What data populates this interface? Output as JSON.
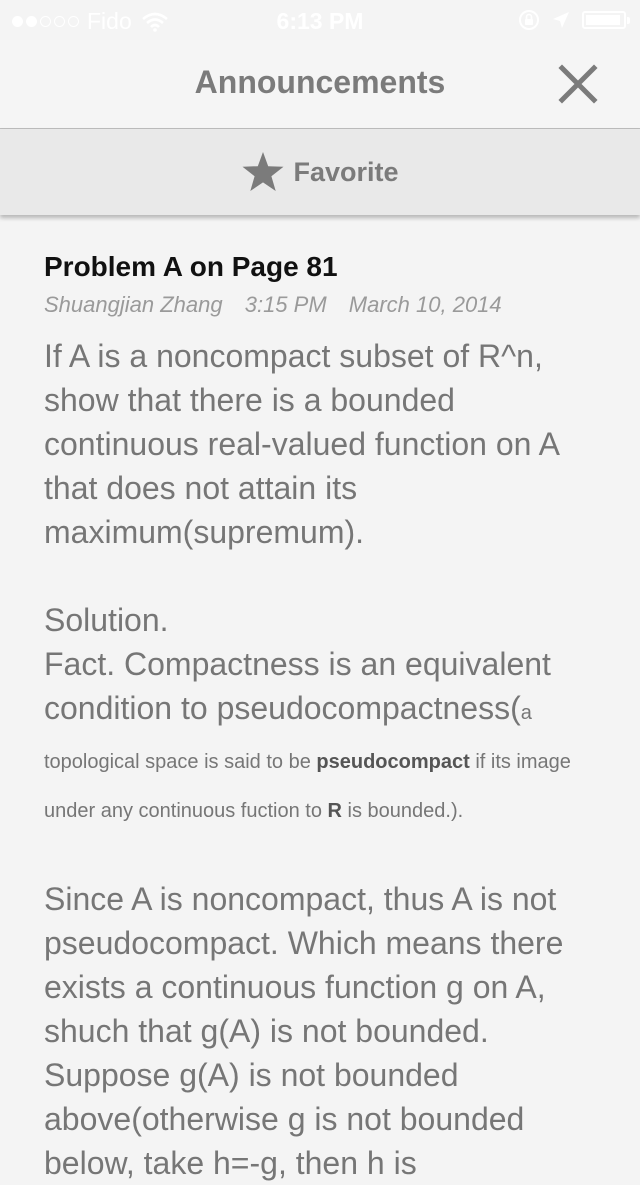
{
  "status": {
    "carrier": "Fido",
    "time": "6:13 PM",
    "signal_bars_filled": 2,
    "signal_bars_total": 5,
    "battery_level_percent": 95
  },
  "nav": {
    "title": "Announcements",
    "close_icon": "close-icon"
  },
  "favorite": {
    "label": "Favorite",
    "icon": "star-icon"
  },
  "post": {
    "title": "Problem A on Page 81",
    "author": "Shuangjian Zhang",
    "time": "3:15 PM",
    "date": "March 10, 2014",
    "problem": "If A is a noncompact subset of R^n, show that there is a bounded continuous real-valued function on A that does not attain its maximum(supremum).",
    "solution_heading": "Solution.",
    "fact_text": "Fact. Compactness is an equivalent condition to pseudocompactness(",
    "note_part1": "a topological space is said to be ",
    "note_bold1": "pseudocompact",
    "note_part2": " if its image under any continuous fuction to ",
    "note_bold2": "R",
    "note_part3": " is bounded.).",
    "argument": "Since A is noncompact, thus A is not pseudocompact. Which means there exists a continuous function g on A, shuch that g(A) is not bounded. Suppose g(A) is not bounded above(otherwise g is not bounded below, take h=-g, then h is"
  },
  "colors": {
    "background": "#f4f4f4",
    "favorite_bar": "#e9e9e9",
    "icon_gray": "#7b7b7b",
    "title_black": "#111111"
  }
}
